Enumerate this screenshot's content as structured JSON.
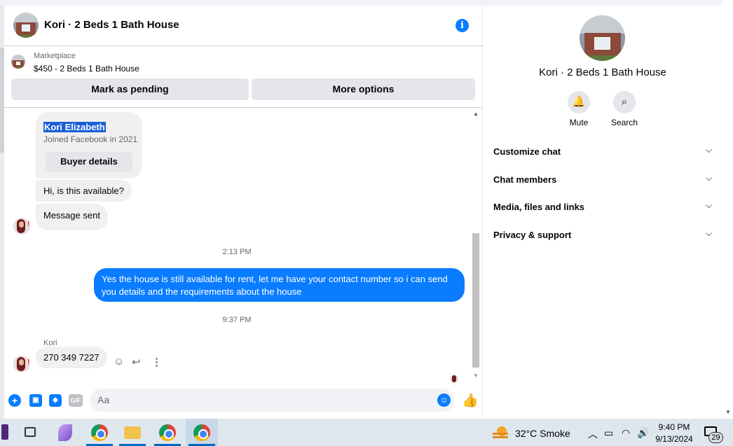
{
  "chat": {
    "header": {
      "title": "Kori · 2 Beds 1 Bath House",
      "info_icon": "info-icon"
    },
    "marketplace": {
      "label": "Marketplace",
      "listing": "$450 - 2 Beds 1 Bath House",
      "mark_pending_label": "Mark as pending",
      "more_options_label": "More options"
    },
    "buyer_card": {
      "name": "Kori Elizabeth",
      "joined": "Joined Facebook in 2021",
      "button_label": "Buyer details"
    },
    "messages": [
      {
        "direction": "incoming",
        "text": "Hi, is this available?"
      },
      {
        "direction": "incoming",
        "text": "Message sent"
      },
      {
        "type": "timestamp",
        "text": "2:13 PM"
      },
      {
        "direction": "outgoing",
        "text": "Yes the house is still available for rent, let me have your contact number so i can send you details and the requirements about the house"
      },
      {
        "type": "timestamp",
        "text": "9:37 PM"
      },
      {
        "direction": "incoming",
        "sender": "Kori",
        "text": "270 349 7227"
      }
    ],
    "composer": {
      "placeholder": "Aa",
      "gif_label": "GIF"
    }
  },
  "panel": {
    "title": "Kori · 2 Beds 1 Bath House",
    "actions": [
      {
        "label": "Mute",
        "icon": "bell-icon"
      },
      {
        "label": "Search",
        "icon": "search-icon"
      }
    ],
    "sections": [
      {
        "label": "Customize chat"
      },
      {
        "label": "Chat members"
      },
      {
        "label": "Media, files and links"
      },
      {
        "label": "Privacy & support"
      }
    ]
  },
  "taskbar": {
    "weather": "32°C  Smoke",
    "time": "9:40 PM",
    "date": "9/13/2024",
    "notification_count": "29"
  },
  "colors": {
    "accent": "#0a7cff",
    "bubble_incoming": "#f0f0f0",
    "button_gray": "#e4e6eb",
    "taskbar": "#dfe7ee"
  }
}
